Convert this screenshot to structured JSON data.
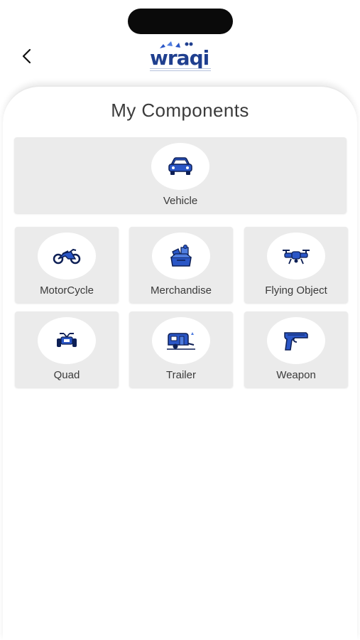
{
  "header": {
    "logo_text": "wraqi"
  },
  "page": {
    "title": "My Components"
  },
  "components": {
    "vehicle": {
      "label": "Vehicle",
      "icon": "car-icon"
    },
    "motorcycle": {
      "label": "MotorCycle",
      "icon": "motorcycle-icon"
    },
    "merchandise": {
      "label": "Merchandise",
      "icon": "merchandise-icon"
    },
    "flying_object": {
      "label": "Flying Object",
      "icon": "drone-icon"
    },
    "quad": {
      "label": "Quad",
      "icon": "quad-icon"
    },
    "trailer": {
      "label": "Trailer",
      "icon": "trailer-icon"
    },
    "weapon": {
      "label": "Weapon",
      "icon": "gun-icon"
    }
  },
  "colors": {
    "icon_blue": "#2a56c6",
    "card_bg": "#ebebeb"
  }
}
